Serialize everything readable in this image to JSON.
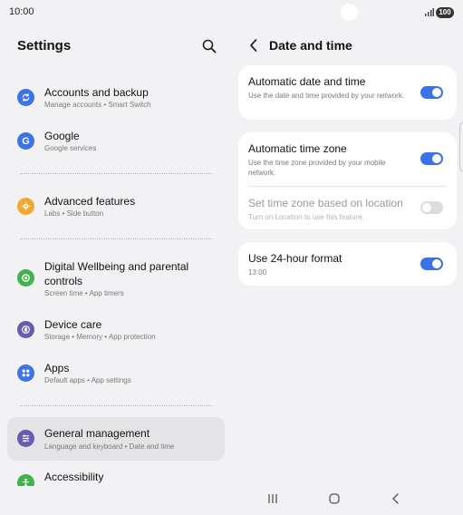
{
  "status_bar": {
    "time": "10:00",
    "battery": "100"
  },
  "settings": {
    "title": "Settings",
    "items": [
      {
        "title": "Accounts and backup",
        "subtitle": "Manage accounts • Smart Switch",
        "icon": "sync-icon",
        "color": "#3e73e8"
      },
      {
        "title": "Google",
        "subtitle": "Google services",
        "icon": "google-icon",
        "color": "#3e73e8"
      },
      {
        "title": "Advanced features",
        "subtitle": "Labs • Side button",
        "icon": "gear-plus-icon",
        "color": "#f0a830"
      },
      {
        "title": "Digital Wellbeing and parental controls",
        "title_line1": "Digital Wellbeing and parental",
        "title_line2": "controls",
        "subtitle": "Screen time • App timers",
        "icon": "wellbeing-icon",
        "color": "#43b14e"
      },
      {
        "title": "Device care",
        "subtitle": "Storage • Memory • App protection",
        "icon": "device-care-icon",
        "color": "#6b5bb0"
      },
      {
        "title": "Apps",
        "subtitle": "Default apps • App settings",
        "icon": "apps-icon",
        "color": "#3e73e8"
      },
      {
        "title": "General management",
        "subtitle": "Language and keyboard • Date and time",
        "icon": "sliders-icon",
        "color": "#6b5bb0"
      },
      {
        "title": "Accessibility",
        "subtitle": "",
        "icon": "accessibility-icon",
        "color": "#43b14e"
      }
    ]
  },
  "date_time": {
    "title": "Date and time",
    "automatic_date": {
      "title": "Automatic date and time",
      "subtitle": "Use the date and time provided by your network.",
      "on": true
    },
    "automatic_zone": {
      "title": "Automatic time zone",
      "subtitle": "Use the time zone provided by your mobile network.",
      "on": true
    },
    "location_zone": {
      "title": "Set time zone based on location",
      "subtitle": "Turn on Location to use this feature.",
      "on": false
    },
    "format_24": {
      "title": "Use 24-hour format",
      "subtitle": "13:00",
      "on": true
    }
  },
  "colors": {
    "accent": "#3a72e8",
    "background": "#f2f2f4",
    "card": "#ffffff"
  }
}
